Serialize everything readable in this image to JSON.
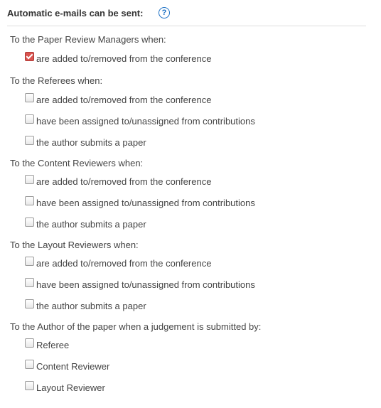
{
  "header": {
    "title": "Automatic e-mails can be sent:",
    "help_icon": "?"
  },
  "sections": [
    {
      "label": "To the Paper Review Managers when:",
      "options": [
        {
          "label": "are added to/removed from the conference",
          "checked": true
        }
      ]
    },
    {
      "label": "To the Referees when:",
      "options": [
        {
          "label": "are added to/removed from the conference",
          "checked": false
        },
        {
          "label": "have been assigned to/unassigned from contributions",
          "checked": false
        },
        {
          "label": "the author submits a paper",
          "checked": false
        }
      ]
    },
    {
      "label": "To the Content Reviewers when:",
      "options": [
        {
          "label": "are added to/removed from the conference",
          "checked": false
        },
        {
          "label": "have been assigned to/unassigned from contributions",
          "checked": false
        },
        {
          "label": "the author submits a paper",
          "checked": false
        }
      ]
    },
    {
      "label": "To the Layout Reviewers when:",
      "options": [
        {
          "label": "are added to/removed from the conference",
          "checked": false
        },
        {
          "label": "have been assigned to/unassigned from contributions",
          "checked": false
        },
        {
          "label": "the author submits a paper",
          "checked": false
        }
      ]
    },
    {
      "label": "To the Author of the paper when a judgement is submitted by:",
      "options": [
        {
          "label": "Referee",
          "checked": false
        },
        {
          "label": "Content Reviewer",
          "checked": false
        },
        {
          "label": "Layout Reviewer",
          "checked": false
        }
      ]
    }
  ]
}
